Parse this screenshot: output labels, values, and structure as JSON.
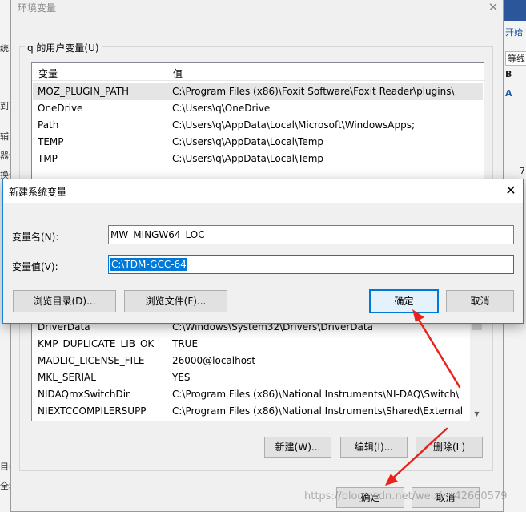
{
  "background_app": {
    "left_fragments": [
      "统",
      "到面",
      "辅音",
      "器设",
      "换依",
      "目参",
      "全和"
    ],
    "right_fragments": {
      "start": "开始",
      "font_box": "等线",
      "bold": "B",
      "a_icon": "A",
      "digit": "7"
    }
  },
  "env_dialog": {
    "title": "环境变量",
    "user_group_label": "q 的用户变量(U)",
    "columns": [
      "变量",
      "值"
    ],
    "user_vars": [
      {
        "name": "MOZ_PLUGIN_PATH",
        "value": "C:\\Program Files (x86)\\Foxit Software\\Foxit Reader\\plugins\\"
      },
      {
        "name": "OneDrive",
        "value": "C:\\Users\\q\\OneDrive"
      },
      {
        "name": "Path",
        "value": "C:\\Users\\q\\AppData\\Local\\Microsoft\\WindowsApps;"
      },
      {
        "name": "TEMP",
        "value": "C:\\Users\\q\\AppData\\Local\\Temp"
      },
      {
        "name": "TMP",
        "value": "C:\\Users\\q\\AppData\\Local\\Temp"
      }
    ],
    "system_vars": [
      {
        "name": "DriverData",
        "value": "C:\\Windows\\System32\\Drivers\\DriverData"
      },
      {
        "name": "KMP_DUPLICATE_LIB_OK",
        "value": "TRUE"
      },
      {
        "name": "MADLIC_LICENSE_FILE",
        "value": "26000@localhost"
      },
      {
        "name": "MKL_SERIAL",
        "value": "YES"
      },
      {
        "name": "NIDAQmxSwitchDir",
        "value": "C:\\Program Files (x86)\\National Instruments\\NI-DAQ\\Switch\\"
      },
      {
        "name": "NIEXTCCOMPILERSUPP",
        "value": "C:\\Program Files (x86)\\National Instruments\\Shared\\External..."
      }
    ],
    "system_buttons": {
      "new": "新建(W)...",
      "edit": "编辑(I)...",
      "delete": "删除(L)"
    },
    "ok": "确定",
    "cancel": "取消"
  },
  "modal": {
    "title": "新建系统变量",
    "name_label": "变量名(N):",
    "name_value": "MW_MINGW64_LOC",
    "value_label": "变量值(V):",
    "value_value": "C:\\TDM-GCC-64",
    "browse_dir": "浏览目录(D)...",
    "browse_file": "浏览文件(F)...",
    "ok": "确定",
    "cancel": "取消"
  },
  "watermark": "https://blog.csdn.net/weixin_42660579",
  "colors": {
    "accent": "#0078d7",
    "annotation": "#e8231c",
    "dialog_bg": "#f0f0f0"
  }
}
